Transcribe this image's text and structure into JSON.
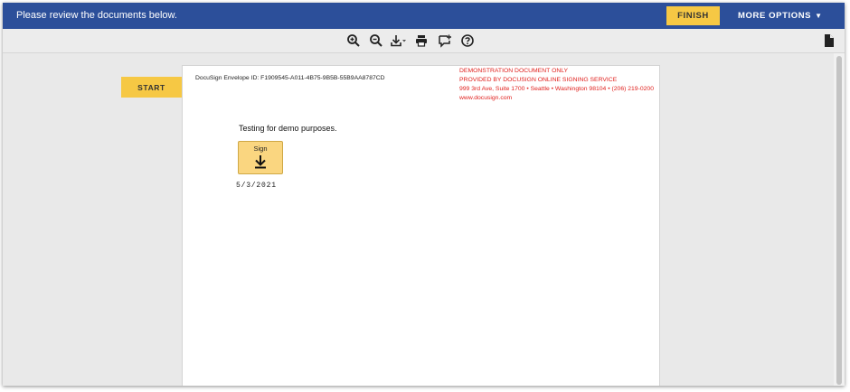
{
  "topbar": {
    "message": "Please review the documents below.",
    "finish_label": "FINISH",
    "more_options_label": "MORE OPTIONS",
    "background": "#2c4f9a",
    "accent": "#f6c844"
  },
  "toolbar": {
    "icons": [
      "zoom-in-icon",
      "zoom-out-icon",
      "download-icon",
      "print-icon",
      "comment-icon",
      "help-icon",
      "page-view-icon"
    ]
  },
  "sidebar": {
    "start_label": "START"
  },
  "document": {
    "envelope_id": "DocuSign Envelope ID: F1909545-A011-4B75-9B5B-55B9AA8787CD",
    "demo_lines": [
      "DEMONSTRATION DOCUMENT ONLY",
      "PROVIDED BY DOCUSIGN ONLINE SIGNING SERVICE",
      "999 3rd Ave, Suite 1700  • Seattle • Washington 98104 • (206) 219-0200",
      "www.docusign.com"
    ],
    "body_text": "Testing for demo purposes.",
    "sign_label": "Sign",
    "date": "5/3/2021",
    "demo_color": "#e0201d"
  }
}
